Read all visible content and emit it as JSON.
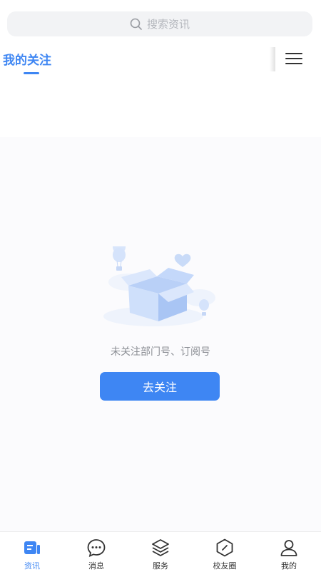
{
  "search": {
    "placeholder": "搜索资讯"
  },
  "tabs": [
    {
      "label": "我的关注",
      "active": true
    }
  ],
  "empty_state": {
    "message": "未关注部门号、订阅号",
    "button_label": "去关注"
  },
  "bottom_nav": [
    {
      "label": "资讯",
      "icon": "news-icon",
      "active": true
    },
    {
      "label": "消息",
      "icon": "message-icon",
      "active": false
    },
    {
      "label": "服务",
      "icon": "layers-icon",
      "active": false
    },
    {
      "label": "校友圈",
      "icon": "compass-icon",
      "active": false
    },
    {
      "label": "我的",
      "icon": "user-icon",
      "active": false
    }
  ],
  "colors": {
    "accent": "#3e86f3",
    "muted_text": "#8c8f95"
  }
}
